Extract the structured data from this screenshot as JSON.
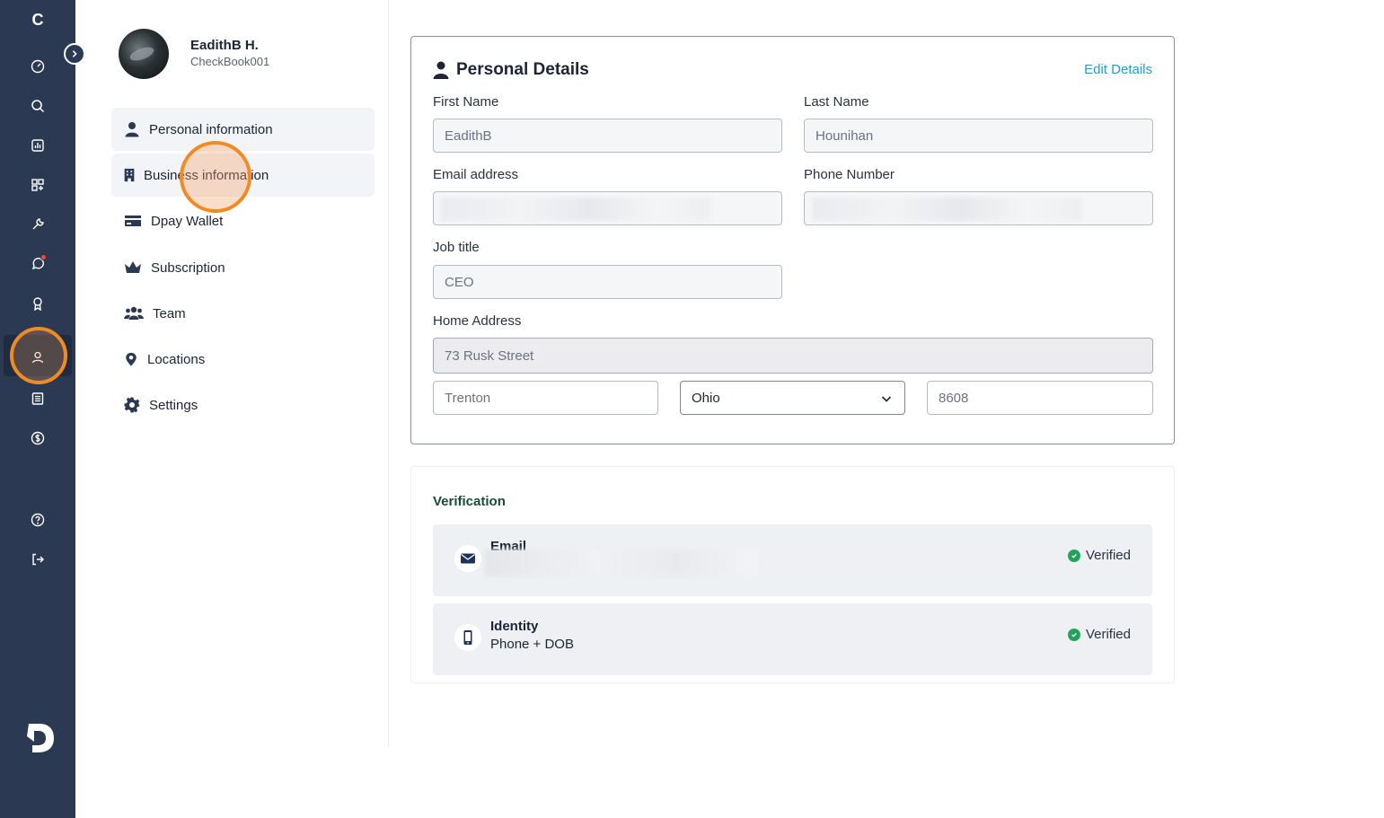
{
  "rail": {
    "brand_letter": "C",
    "icons": [
      "dashboard-icon",
      "search-icon",
      "reports-icon",
      "apps-icon",
      "tools-icon",
      "chat-icon",
      "award-icon",
      "user-icon",
      "ledger-icon",
      "dollar-icon",
      "help-icon",
      "logout-icon"
    ],
    "notification_color": "#e5484d"
  },
  "profile": {
    "name": "EadithB H.",
    "handle": "CheckBook001"
  },
  "menu": {
    "items": [
      {
        "label": "Personal information",
        "icon": "person-icon"
      },
      {
        "label": "Business information",
        "icon": "building-icon"
      },
      {
        "label": "Dpay Wallet",
        "icon": "card-icon"
      },
      {
        "label": "Subscription",
        "icon": "crown-icon"
      },
      {
        "label": "Team",
        "icon": "team-icon"
      },
      {
        "label": "Locations",
        "icon": "location-pin-icon"
      },
      {
        "label": "Settings",
        "icon": "gear-icon"
      }
    ]
  },
  "personal": {
    "title": "Personal Details",
    "edit_label": "Edit Details",
    "first_name_label": "First Name",
    "first_name_value": "EadithB",
    "last_name_label": "Last Name",
    "last_name_value": "Hounihan",
    "email_label": "Email address",
    "phone_label": "Phone Number",
    "job_label": "Job title",
    "job_value": "CEO",
    "address_label": "Home Address",
    "street": "73 Rusk Street",
    "city": "Trenton",
    "state": "Ohio",
    "zip": "8608"
  },
  "verification": {
    "title": "Verification",
    "email_label": "Email",
    "email_status": "Verified",
    "identity_label": "Identity",
    "identity_sub": "Phone + DOB",
    "identity_status": "Verified",
    "accent": "#1aa1c9",
    "verified_color": "#22a35a"
  }
}
